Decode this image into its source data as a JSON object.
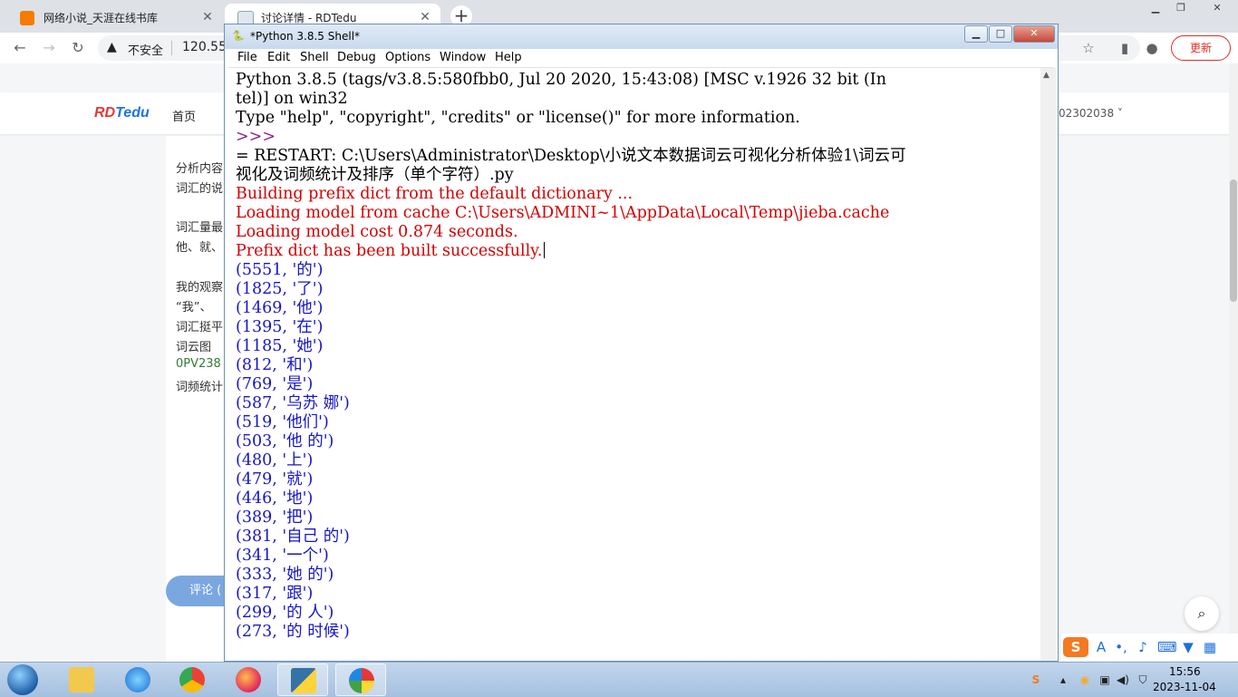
{
  "browser": {
    "tabs": [
      {
        "title": "网络小说_天涯在线书库",
        "active": false
      },
      {
        "title": "讨论详情 - RDTedu",
        "active": true
      }
    ],
    "new_tab_label": "+",
    "address": {
      "security_label": "不安全",
      "url": "120.55"
    },
    "update_label": "更新"
  },
  "page": {
    "logo_part1": "RD",
    "logo_part2": "Tedu",
    "nav_home": "首页",
    "user_id": "02302038",
    "paragraphs": [
      "分析内容",
      "词汇的说",
      "词汇量最",
      "他、就、",
      "我的观察",
      "“我”、",
      "词汇挺平",
      "词云图",
      "0PV238",
      "词频统计"
    ],
    "comment_label": "评论 ("
  },
  "idle": {
    "title": "*Python 3.8.5 Shell*",
    "menu": [
      "File",
      "Edit",
      "Shell",
      "Debug",
      "Options",
      "Window",
      "Help"
    ],
    "lines": [
      {
        "text": "Python 3.8.5 (tags/v3.8.5:580fbb0, Jul 20 2020, 15:43:08) [MSC v.1926 32 bit (In",
        "style": "plain"
      },
      {
        "text": "tel)] on win32",
        "style": "plain"
      },
      {
        "text": "Type \"help\", \"copyright\", \"credits\" or \"license()\" for more information.",
        "style": "plain"
      },
      {
        "text": ">>>",
        "style": "prompt"
      },
      {
        "text": "= RESTART: C:\\Users\\Administrator\\Desktop\\小说文本数据词云可视化分析体验1\\词云可",
        "style": "plain"
      },
      {
        "text": "视化及词频统计及排序（单个字符）.py",
        "style": "plain"
      },
      {
        "text": "Building prefix dict from the default dictionary ...",
        "style": "red"
      },
      {
        "text": "Loading model from cache C:\\Users\\ADMINI~1\\AppData\\Local\\Temp\\jieba.cache",
        "style": "red"
      },
      {
        "text": "Loading model cost 0.874 seconds.",
        "style": "red"
      },
      {
        "text": "Prefix dict has been built successfully.",
        "style": "red"
      },
      {
        "text": "(5551, '的')",
        "style": "blue"
      },
      {
        "text": "(1825, '了')",
        "style": "blue"
      },
      {
        "text": "(1469, '他')",
        "style": "blue"
      },
      {
        "text": "(1395, '在')",
        "style": "blue"
      },
      {
        "text": "(1185, '她')",
        "style": "blue"
      },
      {
        "text": "(812, '和')",
        "style": "blue"
      },
      {
        "text": "(769, '是')",
        "style": "blue"
      },
      {
        "text": "(587, '乌苏 娜')",
        "style": "blue"
      },
      {
        "text": "(519, '他们')",
        "style": "blue"
      },
      {
        "text": "(503, '他 的')",
        "style": "blue"
      },
      {
        "text": "(480, '上')",
        "style": "blue"
      },
      {
        "text": "(479, '就')",
        "style": "blue"
      },
      {
        "text": "(446, '地')",
        "style": "blue"
      },
      {
        "text": "(389, '把')",
        "style": "blue"
      },
      {
        "text": "(381, '自己 的')",
        "style": "blue"
      },
      {
        "text": "(341, '一个')",
        "style": "blue"
      },
      {
        "text": "(333, '她 的')",
        "style": "blue"
      },
      {
        "text": "(317, '跟')",
        "style": "blue"
      },
      {
        "text": "(299, '的 人')",
        "style": "blue"
      },
      {
        "text": "(273, '的 时候')",
        "style": "blue"
      }
    ],
    "colors": {
      "output": "#1616c8",
      "stderr": "#d40000",
      "prompt": "#8a1f8a"
    }
  },
  "taskbar": {
    "apps": [
      "file-explorer",
      "internet-explorer",
      "chrome",
      "firefox",
      "python-idle",
      "pinwheel-app"
    ],
    "clock_time": "15:56",
    "clock_date": "2023-11-04"
  }
}
